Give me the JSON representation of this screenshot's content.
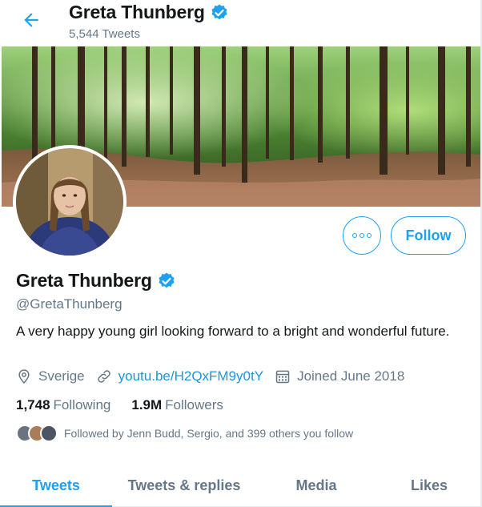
{
  "header": {
    "title": "Greta Thunberg",
    "tweet_count": "5,544 Tweets"
  },
  "profile": {
    "name": "Greta Thunberg",
    "handle": "@GretaThunberg",
    "bio": "A very happy young girl looking forward to a bright and wonderful future.",
    "location": "Sverige",
    "link": "youtu.be/H2QxFM9y0tY",
    "joined": "Joined June 2018",
    "following_count": "1,748",
    "following_label": "Following",
    "followers_count": "1.9M",
    "followers_label": "Followers",
    "followed_by": "Followed by Jenn Budd, Sergio, and 399 others you follow"
  },
  "actions": {
    "follow_label": "Follow"
  },
  "tabs": [
    {
      "label": "Tweets",
      "active": true
    },
    {
      "label": "Tweets & replies",
      "active": false
    },
    {
      "label": "Media",
      "active": false
    },
    {
      "label": "Likes",
      "active": false
    }
  ],
  "colors": {
    "accent": "#1da1f2",
    "link": "#1b95e0",
    "muted": "#657786",
    "text": "#14171a"
  },
  "icons": [
    "back-arrow-icon",
    "verified-badge-icon",
    "more-options-icon",
    "location-pin-icon",
    "link-icon",
    "calendar-icon"
  ]
}
